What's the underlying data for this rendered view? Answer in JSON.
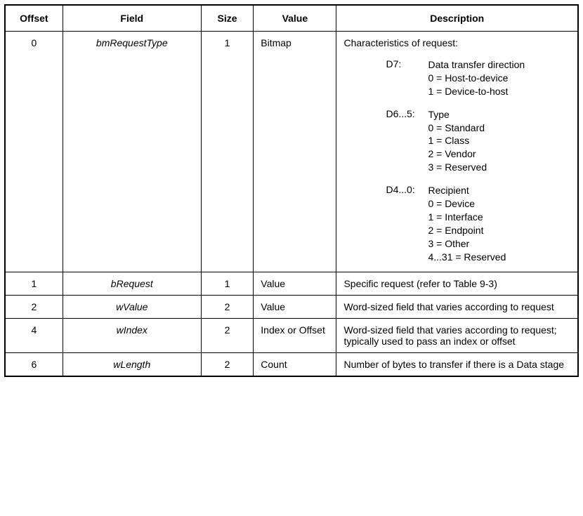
{
  "headers": {
    "offset": "Offset",
    "field": "Field",
    "size": "Size",
    "value": "Value",
    "description": "Description"
  },
  "rows": [
    {
      "offset": "0",
      "field": "bmRequestType",
      "size": "1",
      "value": "Bitmap",
      "desc_intro": "Characteristics of request:",
      "bits": [
        {
          "label": "D7:",
          "title": "Data transfer direction",
          "values": [
            "0 = Host-to-device",
            "1 = Device-to-host"
          ]
        },
        {
          "label": "D6...5:",
          "title": "Type",
          "values": [
            "0 = Standard",
            "1 = Class",
            "2 = Vendor",
            "3 = Reserved"
          ]
        },
        {
          "label": "D4...0:",
          "title": "Recipient",
          "values": [
            "0 = Device",
            "1 = Interface",
            "2 = Endpoint",
            "3 = Other",
            "4...31 = Reserved"
          ]
        }
      ]
    },
    {
      "offset": "1",
      "field": "bRequest",
      "size": "1",
      "value": "Value",
      "description": "Specific request (refer to Table 9-3)"
    },
    {
      "offset": "2",
      "field": "wValue",
      "size": "2",
      "value": "Value",
      "description": "Word-sized field that varies according to request"
    },
    {
      "offset": "4",
      "field": "wIndex",
      "size": "2",
      "value": "Index or Offset",
      "description": "Word-sized field that varies according to request; typically used to pass an index or offset"
    },
    {
      "offset": "6",
      "field": "wLength",
      "size": "2",
      "value": "Count",
      "description": "Number of bytes to transfer if there is a Data stage"
    }
  ]
}
